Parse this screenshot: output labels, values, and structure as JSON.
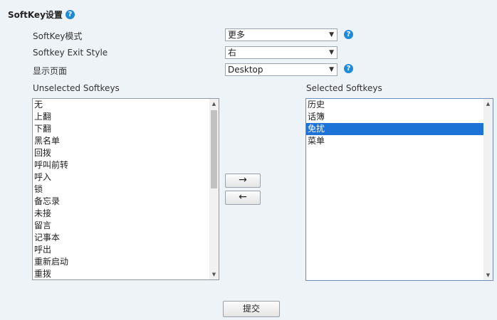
{
  "section": {
    "title": "SoftKey设置"
  },
  "fields": {
    "softkey_mode": {
      "label": "SoftKey模式",
      "value": "更多"
    },
    "exit_style": {
      "label": "Softkey Exit Style",
      "value": "右"
    },
    "display_page": {
      "label": "显示页面",
      "value": "Desktop"
    }
  },
  "unselected": {
    "label": "Unselected Softkeys",
    "items": [
      "无",
      "上翻",
      "下翻",
      "黑名单",
      "回拨",
      "呼叫前转",
      "呼入",
      "锁",
      "备忘录",
      "未接",
      "留言",
      "记事本",
      "呼出",
      "重新启动",
      "重拨"
    ]
  },
  "selected": {
    "label": "Selected Softkeys",
    "items": [
      "历史",
      "话簿",
      "免扰",
      "菜单"
    ],
    "highlighted": "免扰"
  },
  "buttons": {
    "move_right": "→",
    "move_left": "←",
    "submit": "提交"
  },
  "icons": {
    "help": "help-icon",
    "dropdown": "chevron-down-icon"
  },
  "colors": {
    "background": "#eef3f7",
    "accent": "#1e73d6",
    "help": "#1f8ad6"
  }
}
